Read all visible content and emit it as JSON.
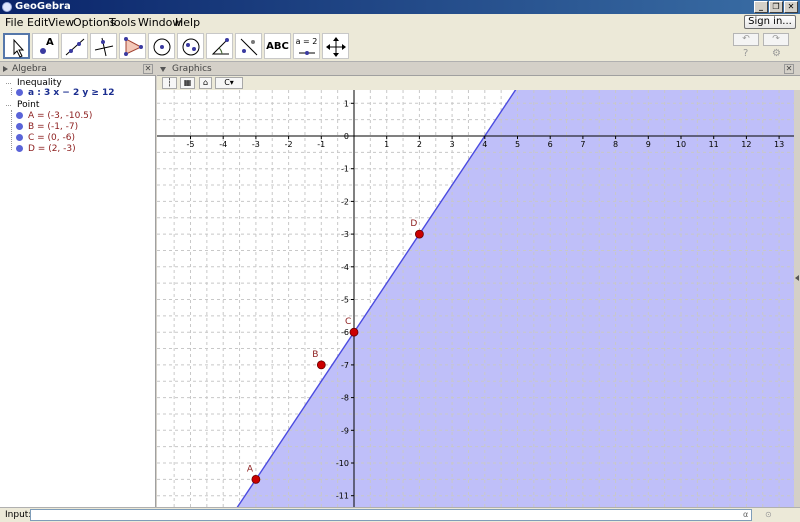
{
  "window": {
    "title": "GeoGebra",
    "controls": [
      "_",
      "❐",
      "✕"
    ]
  },
  "menubar": {
    "items": [
      "File",
      "Edit",
      "View",
      "Options",
      "Tools",
      "Window",
      "Help"
    ],
    "signin_label": "Sign in..."
  },
  "toolbar": {
    "tools": [
      {
        "name": "move",
        "icon": "cursor-arrow-icon"
      },
      {
        "name": "point",
        "icon": "point-icon",
        "label": "A"
      },
      {
        "name": "line",
        "icon": "line-through-points-icon"
      },
      {
        "name": "perpendicular",
        "icon": "perpendicular-line-icon"
      },
      {
        "name": "polygon",
        "icon": "polygon-icon"
      },
      {
        "name": "circle",
        "icon": "circle-center-point-icon"
      },
      {
        "name": "conic",
        "icon": "ellipse-icon"
      },
      {
        "name": "angle",
        "icon": "angle-icon"
      },
      {
        "name": "reflect",
        "icon": "reflect-line-icon"
      },
      {
        "name": "text",
        "icon": "text-icon",
        "label": "ABC"
      },
      {
        "name": "slider",
        "icon": "slider-icon",
        "label": "a = 2"
      },
      {
        "name": "move-view",
        "icon": "move-graphics-icon"
      }
    ],
    "undo_icon": "undo-icon",
    "redo_icon": "redo-icon",
    "help_glyph": "?",
    "gear_glyph": "⚙"
  },
  "algebra": {
    "title": "Algebra",
    "groups": [
      {
        "label": "Inequality",
        "items": [
          {
            "text": "a :  3 x − 2 y ≥ 12",
            "color": "#1a2d8f"
          }
        ]
      },
      {
        "label": "Point",
        "items": [
          {
            "text": "A = (-3, -10.5)",
            "color": "#8b1c1c"
          },
          {
            "text": "B = (-1, -7)",
            "color": "#8b1c1c"
          },
          {
            "text": "C = (0, -6)",
            "color": "#8b1c1c"
          },
          {
            "text": "D = (2, -3)",
            "color": "#8b1c1c"
          }
        ]
      }
    ]
  },
  "graphics": {
    "title": "Graphics",
    "style_bar": [
      "axes-toggle-icon",
      "grid-toggle-icon",
      "home-icon",
      "point-capture-dropdown-icon"
    ],
    "home_glyph": "⌂",
    "capture_glyph": "C▾",
    "shade_color": "#b8b8f8",
    "line_color": "#4b4be0",
    "point_color": "#cc0000",
    "grid_color": "#c8c8c8"
  },
  "chart_data": {
    "type": "scatter",
    "title": "",
    "xlim": [
      -5.5,
      13.3
    ],
    "ylim": [
      -11.3,
      1.4
    ],
    "x_ticks": [
      -5,
      -4,
      -3,
      -2,
      -1,
      0,
      1,
      2,
      3,
      4,
      5,
      6,
      7,
      8,
      9,
      10,
      11,
      12,
      13
    ],
    "y_ticks": [
      1,
      0,
      -1,
      -2,
      -3,
      -4,
      -5,
      -6,
      -7,
      -8,
      -9,
      -10,
      -11
    ],
    "grid": true,
    "inequality": {
      "label": "a",
      "expression": "3x − 2y ≥ 12",
      "boundary_slope": 1.5,
      "boundary_intercept": -6
    },
    "points": [
      {
        "name": "A",
        "x": -3,
        "y": -10.5
      },
      {
        "name": "B",
        "x": -1,
        "y": -7
      },
      {
        "name": "C",
        "x": 0,
        "y": -6
      },
      {
        "name": "D",
        "x": 2,
        "y": -3
      }
    ]
  },
  "inputbar": {
    "label": "Input:",
    "value": "",
    "alpha_glyph": "α",
    "help_glyph": "⊙"
  }
}
